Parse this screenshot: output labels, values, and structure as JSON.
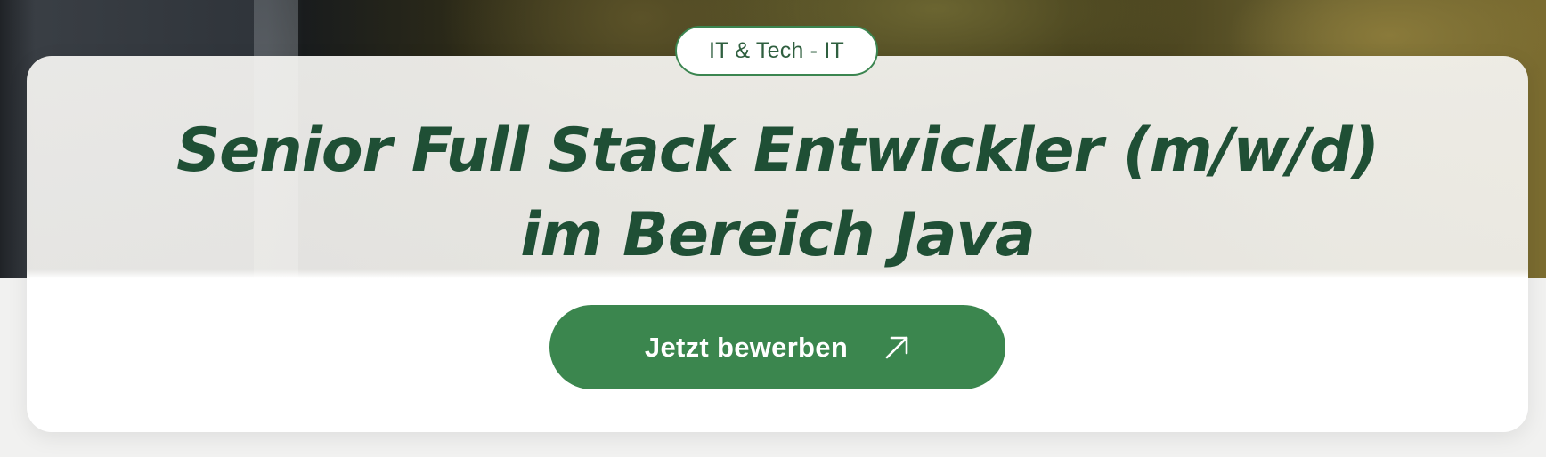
{
  "job": {
    "category": "IT & Tech - IT",
    "title_line1": "Senior Full Stack Entwickler (m/w/d)",
    "title_line2": "im Bereich Java",
    "apply_label": "Jetzt bewerben",
    "apply_icon": "arrow-up-right-icon"
  },
  "colors": {
    "brand_green": "#3b864e",
    "title_green": "#1f4f35",
    "card_background": "#ffffff"
  }
}
